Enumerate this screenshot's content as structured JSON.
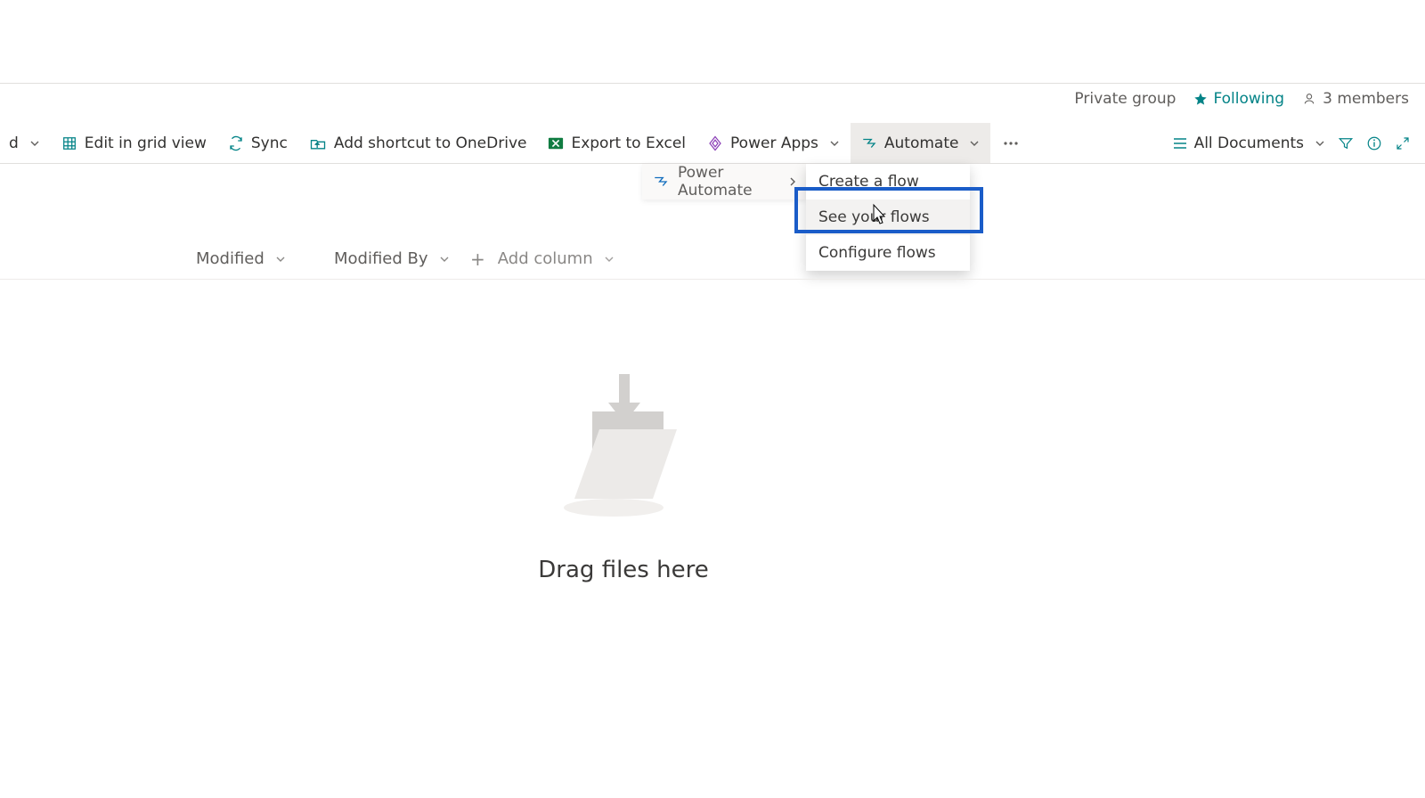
{
  "header": {
    "privacy": "Private group",
    "following": "Following",
    "members": "3 members"
  },
  "commandbar": {
    "chevron_only": "",
    "edit_grid": "Edit in grid view",
    "sync": "Sync",
    "shortcut": "Add shortcut to OneDrive",
    "export_excel": "Export to Excel",
    "power_apps": "Power Apps",
    "automate": "Automate",
    "view_label": "All Documents"
  },
  "automate_menu": {
    "power_automate": "Power Automate",
    "items": {
      "create": "Create a flow",
      "see": "See your flows",
      "configure": "Configure flows"
    }
  },
  "columns": {
    "modified": "Modified",
    "modified_by": "Modified By",
    "add_column": "Add column"
  },
  "empty": {
    "text": "Drag files here"
  }
}
